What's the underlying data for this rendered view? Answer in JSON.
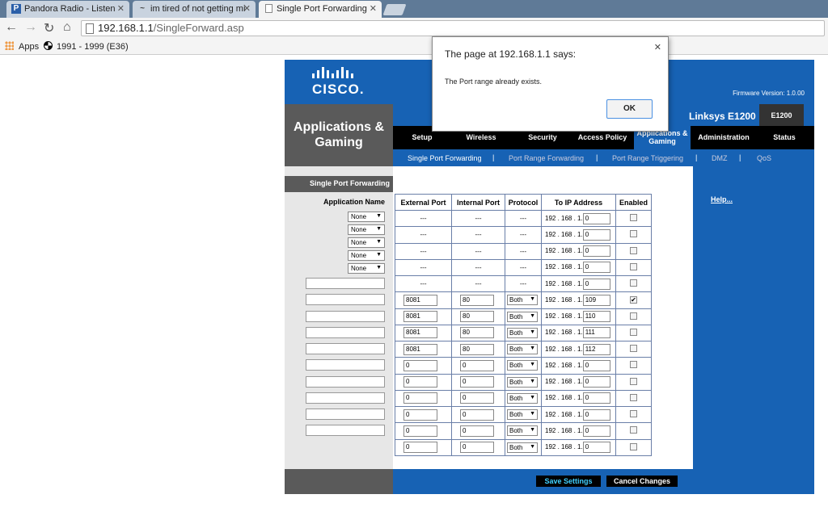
{
  "browser": {
    "tabs": [
      {
        "title": "Pandora Radio - Listen",
        "favicon": "P"
      },
      {
        "title": "im tired of not getting mi",
        "favicon": "~"
      },
      {
        "title": "Single Port Forwarding",
        "favicon": ""
      }
    ],
    "url_host": "192.168.1.1",
    "url_path": "/SingleForward.asp",
    "bookmarks": [
      "Apps",
      "1991 - 1999 (E36)"
    ]
  },
  "router": {
    "logo": "CISCO.",
    "firmware": "Firmware Version: 1.0.00",
    "section_title": "Applications & Gaming",
    "product_name": "Linksys E1200",
    "model": "E1200",
    "nav": [
      "Setup",
      "Wireless",
      "Security",
      "Access Policy",
      "Applications & Gaming",
      "Administration",
      "Status"
    ],
    "subnav": [
      "Single Port Forwarding",
      "Port Range Forwarding",
      "Port Range Triggering",
      "DMZ",
      "QoS"
    ],
    "left_label": "Single Port Forwarding",
    "app_name_header": "Application Name",
    "preset_value": "None",
    "help_link": "Help...",
    "table": {
      "headers": [
        "External Port",
        "Internal Port",
        "Protocol",
        "To IP Address",
        "Enabled"
      ],
      "ip_prefix": "192 . 168 . 1.",
      "rows": [
        {
          "ext": "---",
          "int": "---",
          "proto": "---",
          "ip": "0",
          "enabled": false,
          "editable": false
        },
        {
          "ext": "---",
          "int": "---",
          "proto": "---",
          "ip": "0",
          "enabled": false,
          "editable": false
        },
        {
          "ext": "---",
          "int": "---",
          "proto": "---",
          "ip": "0",
          "enabled": false,
          "editable": false
        },
        {
          "ext": "---",
          "int": "---",
          "proto": "---",
          "ip": "0",
          "enabled": false,
          "editable": false
        },
        {
          "ext": "---",
          "int": "---",
          "proto": "---",
          "ip": "0",
          "enabled": false,
          "editable": false
        },
        {
          "ext": "8081",
          "int": "80",
          "proto": "Both",
          "ip": "109",
          "enabled": true,
          "editable": true
        },
        {
          "ext": "8081",
          "int": "80",
          "proto": "Both",
          "ip": "110",
          "enabled": false,
          "editable": true
        },
        {
          "ext": "8081",
          "int": "80",
          "proto": "Both",
          "ip": "111",
          "enabled": false,
          "editable": true
        },
        {
          "ext": "8081",
          "int": "80",
          "proto": "Both",
          "ip": "112",
          "enabled": false,
          "editable": true
        },
        {
          "ext": "0",
          "int": "0",
          "proto": "Both",
          "ip": "0",
          "enabled": false,
          "editable": true
        },
        {
          "ext": "0",
          "int": "0",
          "proto": "Both",
          "ip": "0",
          "enabled": false,
          "editable": true
        },
        {
          "ext": "0",
          "int": "0",
          "proto": "Both",
          "ip": "0",
          "enabled": false,
          "editable": true
        },
        {
          "ext": "0",
          "int": "0",
          "proto": "Both",
          "ip": "0",
          "enabled": false,
          "editable": true
        },
        {
          "ext": "0",
          "int": "0",
          "proto": "Both",
          "ip": "0",
          "enabled": false,
          "editable": true
        },
        {
          "ext": "0",
          "int": "0",
          "proto": "Both",
          "ip": "0",
          "enabled": false,
          "editable": true
        }
      ]
    },
    "save_label": "Save Settings",
    "cancel_label": "Cancel Changes"
  },
  "dialog": {
    "title": "The page at 192.168.1.1 says:",
    "message": "The Port range already exists.",
    "ok_label": "OK"
  },
  "colors": {
    "brand_blue": "#1762b4",
    "dark_gray": "#5a5a5a"
  }
}
